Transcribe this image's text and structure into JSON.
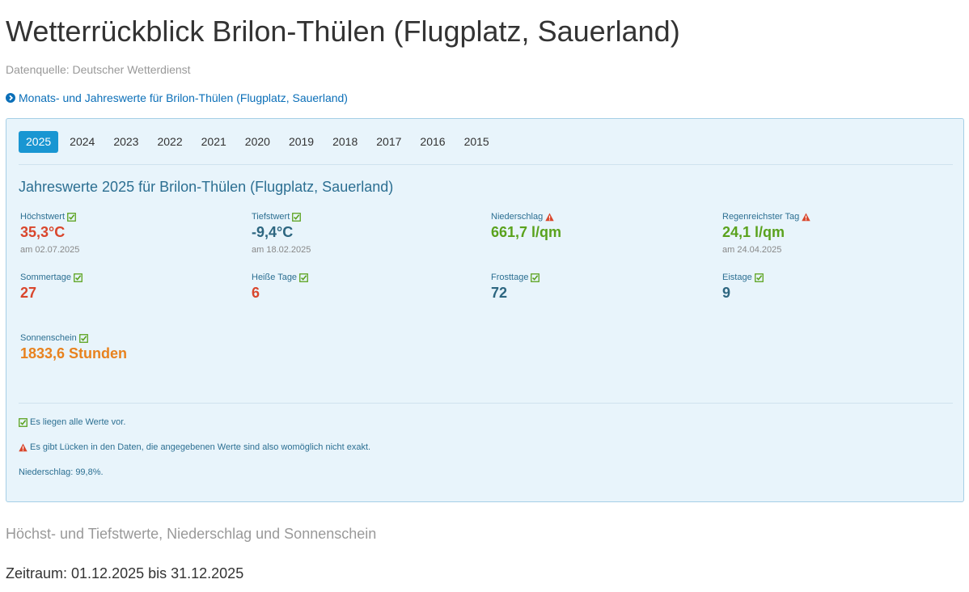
{
  "page": {
    "title": "Wetterrückblick Brilon-Thülen (Flugplatz, Sauerland)",
    "source": "Datenquelle: Deutscher Wetterdienst",
    "monthly_link": "Monats- und Jahreswerte für Brilon-Thülen (Flugplatz, Sauerland)"
  },
  "years": [
    "2025",
    "2024",
    "2023",
    "2022",
    "2021",
    "2020",
    "2019",
    "2018",
    "2017",
    "2016",
    "2015"
  ],
  "active_year": "2025",
  "panel": {
    "title": "Jahreswerte 2025 für Brilon-Thülen (Flugplatz, Sauerland)",
    "stats": {
      "max_temp": {
        "label": "Höchstwert",
        "value": "35,3°C",
        "date": "am 02.07.2025",
        "status_icon": "check-icon"
      },
      "min_temp": {
        "label": "Tiefstwert",
        "value": "-9,4°C",
        "date": "am 18.02.2025",
        "status_icon": "check-icon"
      },
      "precipitation": {
        "label": "Niederschlag",
        "value": "661,7 l/qm",
        "status_icon": "warning-icon"
      },
      "wettest_day": {
        "label": "Regenreichster Tag",
        "value": "24,1 l/qm",
        "date": "am 24.04.2025",
        "status_icon": "warning-icon"
      },
      "summer_days": {
        "label": "Sommertage",
        "value": "27",
        "status_icon": "check-icon"
      },
      "hot_days": {
        "label": "Heiße Tage",
        "value": "6",
        "status_icon": "check-icon"
      },
      "frost_days": {
        "label": "Frosttage",
        "value": "72",
        "status_icon": "check-icon"
      },
      "ice_days": {
        "label": "Eistage",
        "value": "9",
        "status_icon": "check-icon"
      },
      "sunshine": {
        "label": "Sonnenschein",
        "value": "1833,6 Stunden",
        "status_icon": "check-icon"
      }
    },
    "notes": {
      "all_values": "Es liegen alle Werte vor.",
      "gaps": "Es gibt Lücken in den Daten, die angegebenen Werte sind also womöglich nicht exakt.",
      "precip_coverage": "Niederschlag: 99,8%."
    }
  },
  "section_heading": "Höchst- und Tiefstwerte, Niederschlag und Sonnenschein",
  "period": "Zeitraum: 01.12.2025 bis 31.12.2025",
  "colors": {
    "accent": "#1996d2",
    "link": "#0b6fb8",
    "red": "#d9462c",
    "green": "#5aa21d",
    "orange": "#e8821e",
    "blue": "#2d6680",
    "panel_bg": "#e8f4fb"
  }
}
